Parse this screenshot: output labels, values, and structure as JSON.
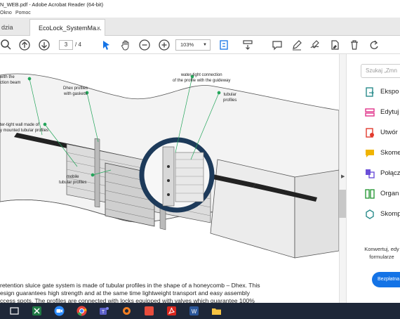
{
  "window": {
    "title": "N_WEB.pdf - Adobe Acrobat Reader (64-bit)"
  },
  "menu": {
    "items": [
      "Okno",
      "Pomoc"
    ]
  },
  "tabs": {
    "home": "dzia",
    "document": "EcoLock_SystemMa...",
    "close": "×"
  },
  "toolbar": {
    "page_current": "3",
    "page_total": "/ 4",
    "zoom": "103%",
    "zoom_caret": "▼"
  },
  "figure": {
    "callouts": {
      "top_left": "with the\nction beam",
      "dhex": "Dhex profiles\nwith gaskets",
      "watertight_conn": "water-tight connection\nof the profile with the guideway",
      "tubular": "tubular\nprofiles",
      "wall": "ter-tight wall made of\ny mounted tubular profiles",
      "mobile": "mobile\ntubular profiles"
    },
    "colors": {
      "accent_green": "#23a55a",
      "ring_navy": "#1d3a5a"
    }
  },
  "body_text": {
    "line1": "retention sluice gate system is made of tubular profiles in the shape of a honeycomb – Dhex. This",
    "line2": "esign guarantees high strength and at the same time lightweight transport and easy assembly",
    "line3": "ccess spots. The profiles are connected with locks equipped with valves which guarantee 100%"
  },
  "right_panel": {
    "search_placeholder": "Szukaj „Zmn",
    "tools": [
      {
        "label": "Ekspo",
        "icon": "export-pdf-icon",
        "color": "#2a8c8c"
      },
      {
        "label": "Edytuj",
        "icon": "edit-pdf-icon",
        "color": "#e0348a"
      },
      {
        "label": "Utwór",
        "icon": "create-pdf-icon",
        "color": "#e23b2e"
      },
      {
        "label": "Skome",
        "icon": "comment-icon",
        "color": "#f0b400"
      },
      {
        "label": "Połącz",
        "icon": "combine-files-icon",
        "color": "#6b4fd8"
      },
      {
        "label": "Organ",
        "icon": "organize-pages-icon",
        "color": "#2c9a3a"
      },
      {
        "label": "Skomp",
        "icon": "compress-pdf-icon",
        "color": "#2a8c8c"
      }
    ],
    "promo_text": "Konwertuj, edy formularze",
    "promo_button": "Bezpłatna"
  },
  "taskbar": {
    "apps": [
      "task-view-icon",
      "excel-icon",
      "zoom-icon",
      "chrome-icon",
      "teams-icon",
      "onedrive-icon",
      "office-icon",
      "acrobat-icon",
      "word-icon",
      "file-explorer-icon"
    ]
  }
}
